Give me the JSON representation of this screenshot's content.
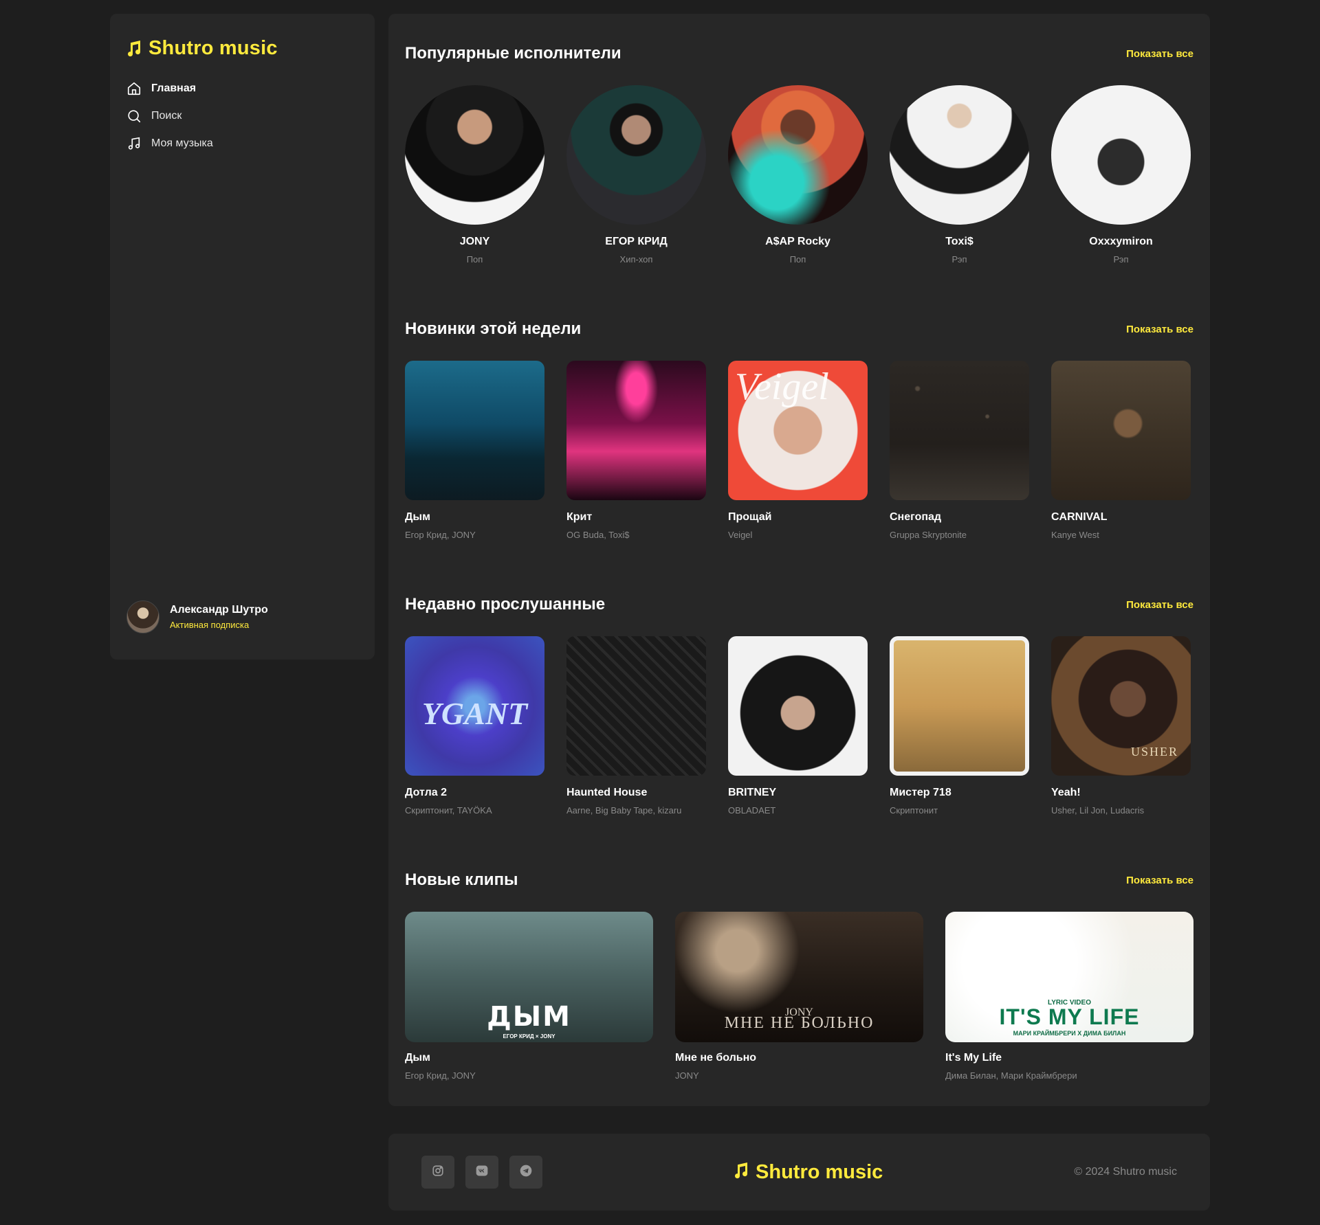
{
  "brand": {
    "name": "Shutro music",
    "accent": "#ffea3d",
    "icon": "music-note-icon"
  },
  "nav": [
    {
      "label": "Главная",
      "icon": "home-icon",
      "active": true
    },
    {
      "label": "Поиск",
      "icon": "search-icon",
      "active": false
    },
    {
      "label": "Моя музыка",
      "icon": "music-note-icon",
      "active": false
    }
  ],
  "user": {
    "name": "Александр Шутро",
    "status": "Активная подписка"
  },
  "sections": {
    "artists": {
      "title": "Популярные исполнители",
      "show_all": "Показать все",
      "items": [
        {
          "name": "JONY",
          "genre": "Поп"
        },
        {
          "name": "ЕГОР КРИД",
          "genre": "Хип-хоп"
        },
        {
          "name": "A$AP Rocky",
          "genre": "Поп"
        },
        {
          "name": "Toxi$",
          "genre": "Рэп"
        },
        {
          "name": "Oxxxymiron",
          "genre": "Рэп"
        }
      ]
    },
    "new_releases": {
      "title": "Новинки этой недели",
      "show_all": "Показать все",
      "items": [
        {
          "title": "Дым",
          "artist": "Егор Крид, JONY"
        },
        {
          "title": "Крит",
          "artist": "OG Buda, Toxi$"
        },
        {
          "title": "Прощай",
          "artist": "Veigel"
        },
        {
          "title": "Снегопад",
          "artist": "Gruppa Skryptonite"
        },
        {
          "title": "CARNIVAL",
          "artist": "Kanye West"
        }
      ]
    },
    "recent": {
      "title": "Недавно прослушанные",
      "show_all": "Показать все",
      "items": [
        {
          "title": "Дотла 2",
          "artist": "Скриптонит, TAYÖKA"
        },
        {
          "title": "Haunted House",
          "artist": "Aarne, Big Baby Tape, kizaru"
        },
        {
          "title": "BRITNEY",
          "artist": "OBLADAET"
        },
        {
          "title": "Мистер 718",
          "artist": "Скриптонит"
        },
        {
          "title": "Yeah!",
          "artist": "Usher, Lil Jon, Ludacris"
        }
      ]
    },
    "clips": {
      "title": "Новые клипы",
      "show_all": "Показать все",
      "items": [
        {
          "title": "Дым",
          "artist": "Егор Крид, JONY"
        },
        {
          "title": "Мне не больно",
          "artist": "JONY"
        },
        {
          "title": "It's My Life",
          "artist": "Дима Билан, Мари Краймбрери"
        }
      ]
    }
  },
  "artwork_text": {
    "veigel": "Veigel",
    "dotla": "YGANT",
    "usher": "USHER",
    "clip_dym": "ДЫМ",
    "clip_dym_sub": "ЕГОР КРИД × JONY",
    "clip_jony_name": "JONY",
    "clip_jony_title": "МНЕ НЕ БОЛЬНО",
    "clip_life_top": "LYRIC VIDEO",
    "clip_life": "IT'S MY LIFE",
    "clip_life_sub": "МАРИ КРАЙМБРЕРИ Х ДИМА БИЛАН"
  },
  "footer": {
    "socials": [
      "instagram-icon",
      "vk-icon",
      "telegram-icon"
    ],
    "copyright": "© 2024  Shutro music"
  }
}
